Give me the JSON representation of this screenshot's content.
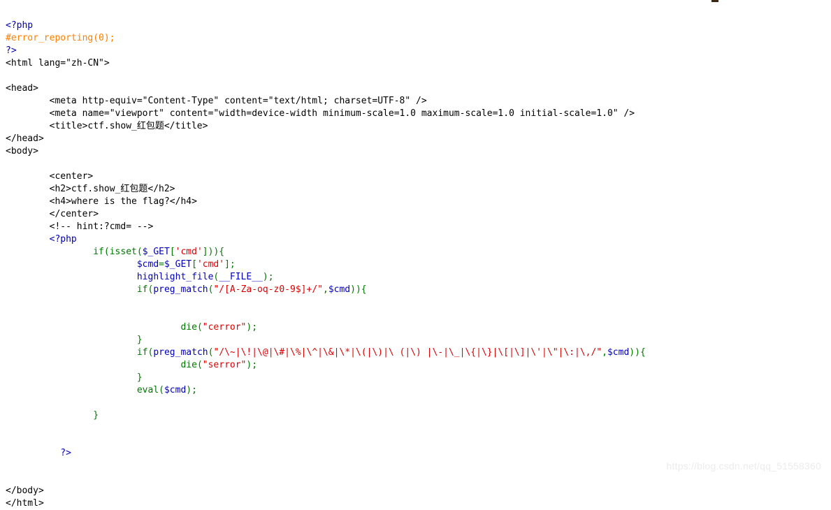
{
  "page": {
    "kind": "php-highlight-file-output",
    "background": "#ffffff",
    "watermark": "https://blog.csdn.net/qq_51558360"
  },
  "colors": {
    "php_tag": "#0000BB",
    "keyword": "#007700",
    "string": "#DD0000",
    "variable": "#0000BB",
    "comment": "#FF8000",
    "html": "#000000",
    "watermark": "#ececec"
  },
  "code": {
    "lines": [
      {
        "n": 1,
        "indent": 0,
        "tokens": [
          {
            "t": "<?php",
            "c": "php-tag"
          }
        ]
      },
      {
        "n": 2,
        "indent": 0,
        "tokens": [
          {
            "t": "#error_reporting(0);",
            "c": "cmt"
          }
        ]
      },
      {
        "n": 3,
        "indent": 0,
        "tokens": [
          {
            "t": "?>",
            "c": "php-tag"
          }
        ]
      },
      {
        "n": 4,
        "indent": 0,
        "tokens": [
          {
            "t": "<html lang=\"zh-CN\">",
            "c": "html"
          }
        ]
      },
      {
        "n": 5,
        "indent": 0,
        "tokens": []
      },
      {
        "n": 6,
        "indent": 0,
        "tokens": [
          {
            "t": "<head>",
            "c": "html"
          }
        ]
      },
      {
        "n": 7,
        "indent": 8,
        "tokens": [
          {
            "t": "<meta http-equiv=\"Content-Type\" content=\"text/html; charset=UTF-8\" />",
            "c": "html"
          }
        ]
      },
      {
        "n": 8,
        "indent": 8,
        "tokens": [
          {
            "t": "<meta name=\"viewport\" content=\"width=device-width minimum-scale=1.0 maximum-scale=1.0 initial-scale=1.0\" />",
            "c": "html"
          }
        ]
      },
      {
        "n": 9,
        "indent": 8,
        "tokens": [
          {
            "t": "<title>ctf.show_红包题</title>",
            "c": "html"
          }
        ]
      },
      {
        "n": 10,
        "indent": 0,
        "tokens": [
          {
            "t": "</head>",
            "c": "html"
          }
        ]
      },
      {
        "n": 11,
        "indent": 0,
        "tokens": [
          {
            "t": "<body>",
            "c": "html"
          }
        ]
      },
      {
        "n": 12,
        "indent": 0,
        "tokens": []
      },
      {
        "n": 13,
        "indent": 8,
        "tokens": [
          {
            "t": "<center>",
            "c": "html"
          }
        ]
      },
      {
        "n": 14,
        "indent": 8,
        "tokens": [
          {
            "t": "<h2>ctf.show_红包题</h2>",
            "c": "html"
          }
        ]
      },
      {
        "n": 15,
        "indent": 8,
        "tokens": [
          {
            "t": "<h4>where is the flag?</h4>",
            "c": "html"
          }
        ]
      },
      {
        "n": 16,
        "indent": 8,
        "tokens": [
          {
            "t": "</center>",
            "c": "html"
          }
        ]
      },
      {
        "n": 17,
        "indent": 8,
        "tokens": [
          {
            "t": "<!-- hint:?cmd= -->",
            "c": "html"
          }
        ]
      },
      {
        "n": 18,
        "indent": 8,
        "tokens": [
          {
            "t": "<?php",
            "c": "php-tag"
          }
        ]
      },
      {
        "n": 19,
        "indent": 16,
        "tokens": [
          {
            "t": "if",
            "c": "kw"
          },
          {
            "t": "(",
            "c": "kw"
          },
          {
            "t": "isset",
            "c": "kw"
          },
          {
            "t": "(",
            "c": "kw"
          },
          {
            "t": "$_GET",
            "c": "var"
          },
          {
            "t": "[",
            "c": "kw"
          },
          {
            "t": "'cmd'",
            "c": "str"
          },
          {
            "t": "]",
            "c": "kw"
          },
          {
            "t": "))",
            "c": "kw"
          },
          {
            "t": "{",
            "c": "kw"
          }
        ]
      },
      {
        "n": 20,
        "indent": 24,
        "tokens": [
          {
            "t": "$cmd",
            "c": "var"
          },
          {
            "t": "=",
            "c": "kw"
          },
          {
            "t": "$_GET",
            "c": "var"
          },
          {
            "t": "[",
            "c": "kw"
          },
          {
            "t": "'cmd'",
            "c": "str"
          },
          {
            "t": "];",
            "c": "kw"
          }
        ]
      },
      {
        "n": 21,
        "indent": 24,
        "tokens": [
          {
            "t": "highlight_file",
            "c": "var"
          },
          {
            "t": "(",
            "c": "kw"
          },
          {
            "t": "__FILE__",
            "c": "var"
          },
          {
            "t": ");",
            "c": "kw"
          }
        ]
      },
      {
        "n": 22,
        "indent": 24,
        "tokens": [
          {
            "t": "if",
            "c": "kw"
          },
          {
            "t": "(",
            "c": "kw"
          },
          {
            "t": "preg_match",
            "c": "var"
          },
          {
            "t": "(",
            "c": "kw"
          },
          {
            "t": "\"/[A-Za-oq-z0-9$]+/\"",
            "c": "str"
          },
          {
            "t": ",",
            "c": "kw"
          },
          {
            "t": "$cmd",
            "c": "var"
          },
          {
            "t": "))",
            "c": "kw"
          },
          {
            "t": "{",
            "c": "kw"
          }
        ]
      },
      {
        "n": 23,
        "indent": 0,
        "tokens": []
      },
      {
        "n": 24,
        "indent": 0,
        "tokens": []
      },
      {
        "n": 25,
        "indent": 32,
        "tokens": [
          {
            "t": "die",
            "c": "kw"
          },
          {
            "t": "(",
            "c": "kw"
          },
          {
            "t": "\"cerror\"",
            "c": "str"
          },
          {
            "t": ");",
            "c": "kw"
          }
        ]
      },
      {
        "n": 26,
        "indent": 24,
        "tokens": [
          {
            "t": "}",
            "c": "kw"
          }
        ]
      },
      {
        "n": 27,
        "indent": 24,
        "tokens": [
          {
            "t": "if",
            "c": "kw"
          },
          {
            "t": "(",
            "c": "kw"
          },
          {
            "t": "preg_match",
            "c": "var"
          },
          {
            "t": "(",
            "c": "kw"
          },
          {
            "t": "\"/\\~|\\!|\\@|\\#|\\%|\\^|\\&|\\*|\\(|\\)|\\ (|\\) |\\-|\\_|\\{|\\}|\\[|\\]|\\'|\\\"|\\:|\\,/\"",
            "c": "str"
          },
          {
            "t": ",",
            "c": "kw"
          },
          {
            "t": "$cmd",
            "c": "var"
          },
          {
            "t": "))",
            "c": "kw"
          },
          {
            "t": "{",
            "c": "kw"
          }
        ]
      },
      {
        "n": 28,
        "indent": 32,
        "tokens": [
          {
            "t": "die",
            "c": "kw"
          },
          {
            "t": "(",
            "c": "kw"
          },
          {
            "t": "\"serror\"",
            "c": "str"
          },
          {
            "t": ");",
            "c": "kw"
          }
        ]
      },
      {
        "n": 29,
        "indent": 24,
        "tokens": [
          {
            "t": "}",
            "c": "kw"
          }
        ]
      },
      {
        "n": 30,
        "indent": 24,
        "tokens": [
          {
            "t": "eval",
            "c": "kw"
          },
          {
            "t": "(",
            "c": "kw"
          },
          {
            "t": "$cmd",
            "c": "var"
          },
          {
            "t": ");",
            "c": "kw"
          }
        ]
      },
      {
        "n": 31,
        "indent": 0,
        "tokens": []
      },
      {
        "n": 32,
        "indent": 16,
        "tokens": [
          {
            "t": "}",
            "c": "kw"
          }
        ]
      },
      {
        "n": 33,
        "indent": 0,
        "tokens": []
      },
      {
        "n": 34,
        "indent": 0,
        "tokens": []
      },
      {
        "n": 35,
        "indent": 10,
        "tokens": [
          {
            "t": "?>",
            "c": "php-tag"
          }
        ]
      },
      {
        "n": 36,
        "indent": 0,
        "tokens": []
      },
      {
        "n": 37,
        "indent": 0,
        "tokens": []
      },
      {
        "n": 38,
        "indent": 0,
        "tokens": [
          {
            "t": "</body>",
            "c": "html"
          }
        ]
      },
      {
        "n": 39,
        "indent": 0,
        "tokens": [
          {
            "t": "</html>",
            "c": "html"
          }
        ]
      }
    ]
  }
}
